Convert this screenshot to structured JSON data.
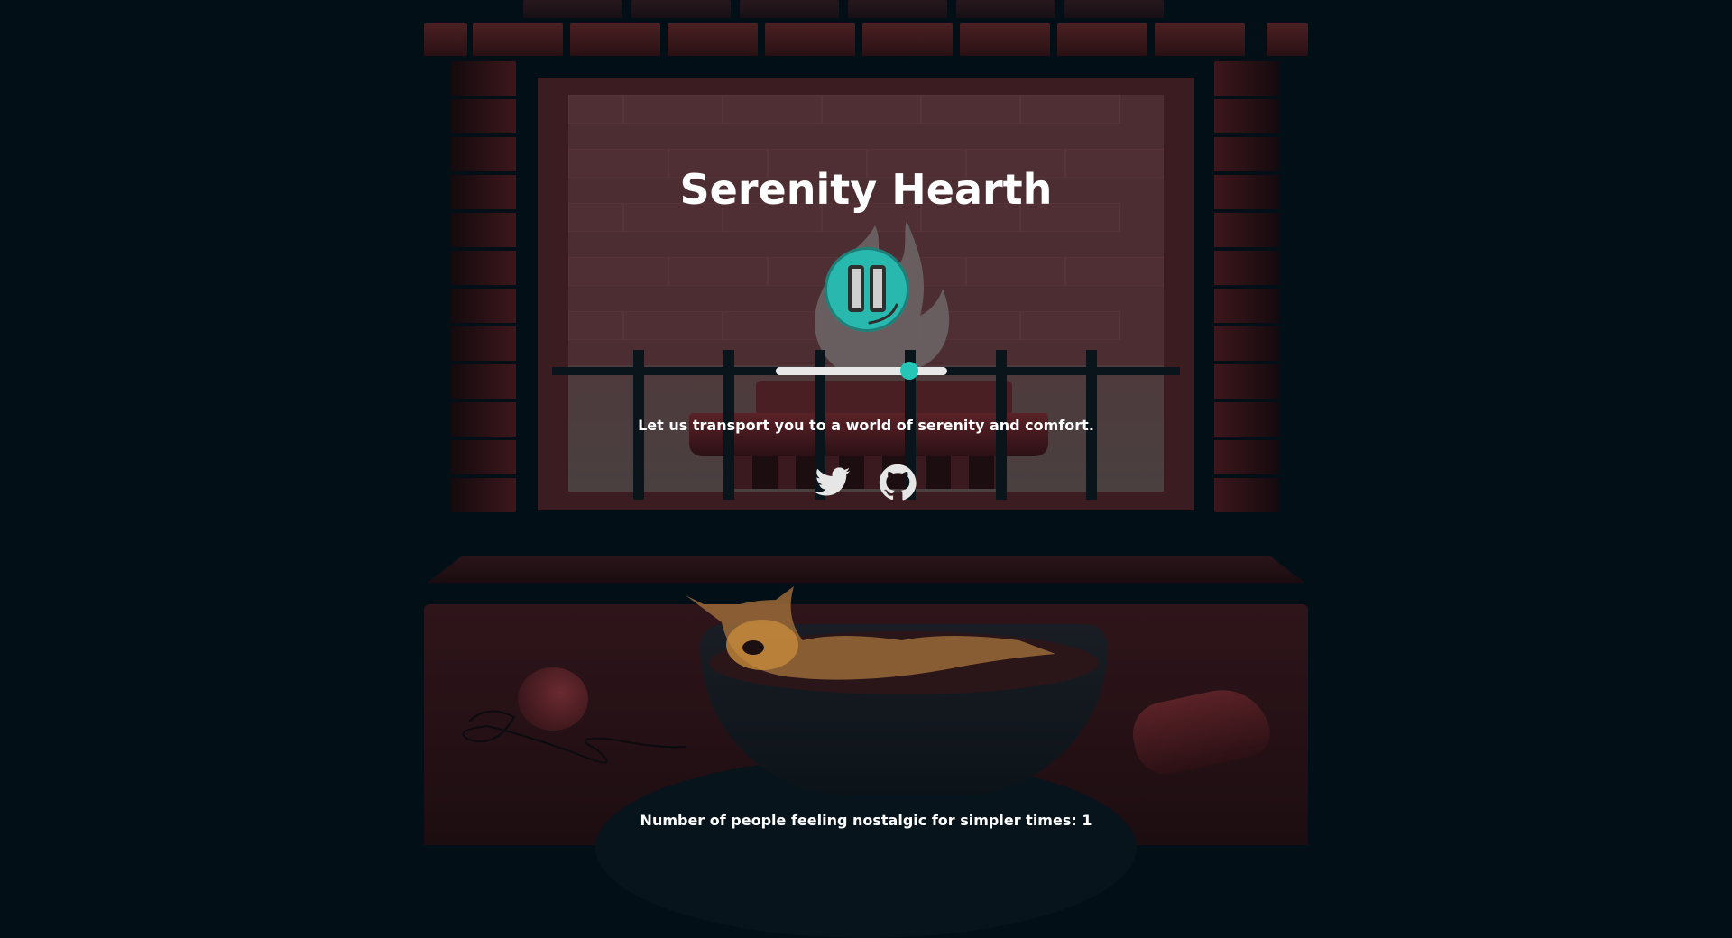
{
  "app": {
    "title": "Serenity Hearth",
    "tagline": "Let us transport you to a world of serenity and comfort.",
    "counter_text": "Number of people feeling nostalgic for simpler times: 1"
  },
  "player": {
    "state": "playing",
    "button_icon": "pause-icon",
    "volume": 0.78
  },
  "social": {
    "items": [
      {
        "icon": "twitter-icon"
      },
      {
        "icon": "github-icon"
      }
    ]
  },
  "colors": {
    "accent": "#28b8ae",
    "background": "#030f17",
    "brick": "#4a2022",
    "text": "#ffffff"
  }
}
